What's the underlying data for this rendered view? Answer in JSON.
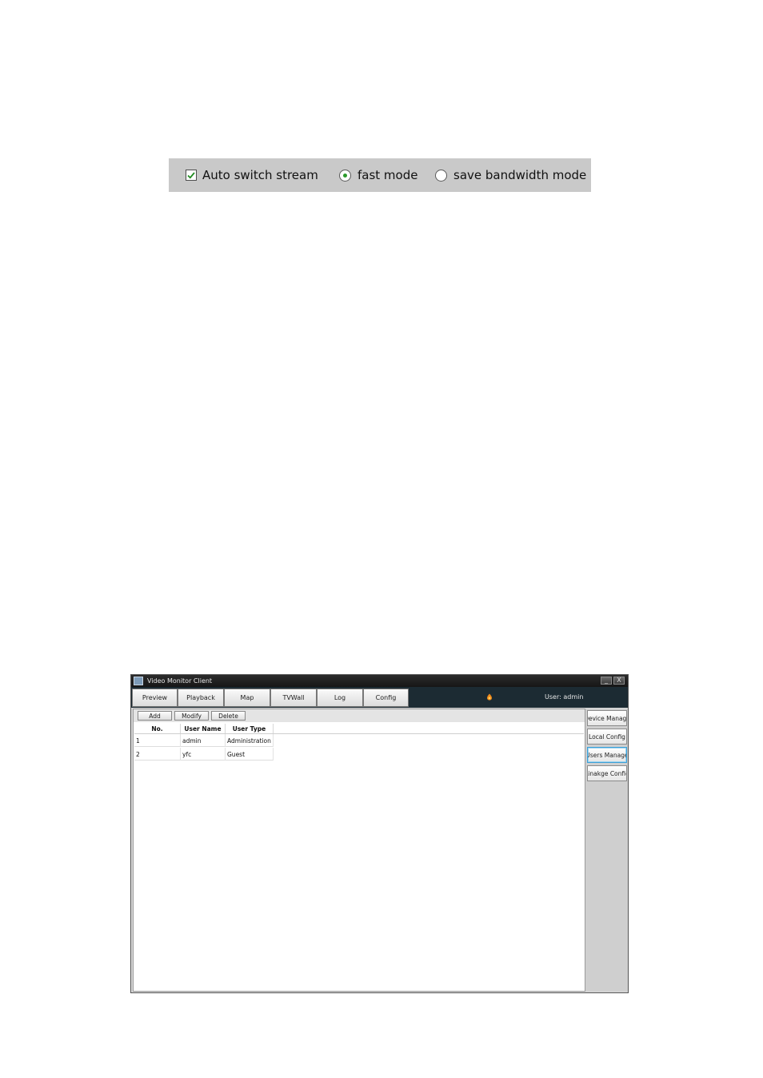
{
  "stream_options": {
    "auto_switch": {
      "label": "Auto switch stream",
      "checked": true
    },
    "modes": [
      {
        "label": "fast mode",
        "selected": true
      },
      {
        "label": "save bandwidth mode",
        "selected": false
      }
    ]
  },
  "window": {
    "title": "Video Monitor Client",
    "controls": {
      "minimize": "_",
      "close": "X"
    },
    "nav_tabs": [
      {
        "label": "Preview"
      },
      {
        "label": "Playback"
      },
      {
        "label": "Map"
      },
      {
        "label": "TVWall"
      },
      {
        "label": "Log"
      },
      {
        "label": "Config"
      }
    ],
    "user_label": "User: admin",
    "toolbar": {
      "add": "Add",
      "modify": "Modify",
      "delete": "Delete"
    },
    "table": {
      "columns": [
        "No.",
        "User Name",
        "User Type"
      ],
      "rows": [
        [
          "1",
          "admin",
          "Administration"
        ],
        [
          "2",
          "yfc",
          "Guest"
        ]
      ]
    },
    "sidebar": [
      {
        "label": "Device Manage",
        "active": false
      },
      {
        "label": "Local Config",
        "active": false
      },
      {
        "label": "Users Manage",
        "active": true
      },
      {
        "label": "Linakge Config",
        "active": false
      }
    ]
  }
}
